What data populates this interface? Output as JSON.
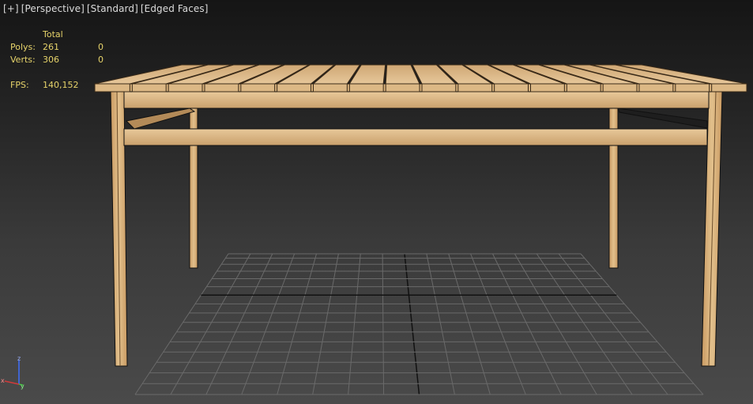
{
  "viewport": {
    "labels": [
      "[+]",
      "[Perspective]",
      "[Standard]",
      "[Edged Faces]"
    ]
  },
  "stats": {
    "header": "Total",
    "polys_label": "Polys:",
    "polys_value": "261",
    "polys_selected": "0",
    "verts_label": "Verts:",
    "verts_value": "306",
    "verts_selected": "0",
    "fps_label": "FPS:",
    "fps_value": "140,152"
  },
  "gizmo": {
    "x_label": "x",
    "y_label": "y",
    "z_label": "z"
  },
  "colors": {
    "wood": "#d9b27c",
    "wood_dark": "#a67c4a",
    "grid": "#6a6a6a",
    "grid_axis": "#111111",
    "stats_text": "#e6d36a"
  }
}
